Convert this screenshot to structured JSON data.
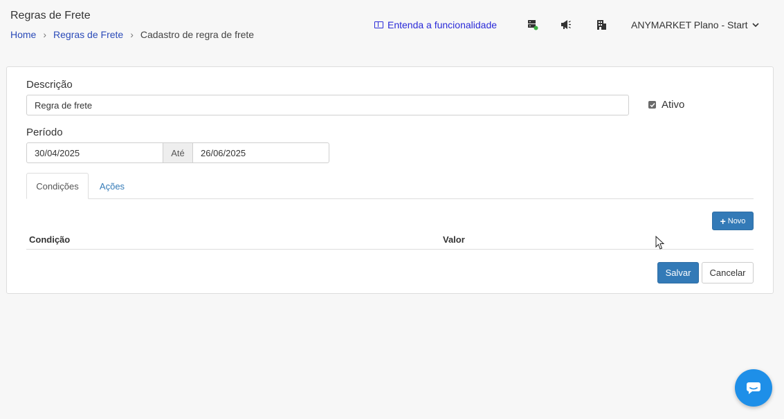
{
  "header": {
    "title": "Regras de Frete",
    "breadcrumb": [
      "Home",
      "Regras de Frete",
      "Cadastro de regra de frete"
    ],
    "help_link": "Entenda a funcionalidade",
    "icons": [
      "server-status-icon",
      "megaphone-icon",
      "building-icon"
    ],
    "account": "ANYMARKET Plano - Start"
  },
  "form": {
    "descricao_label": "Descrição",
    "descricao_value": "Regra de frete",
    "ativo_label": "Ativo",
    "ativo_checked": true,
    "periodo_label": "Período",
    "periodo_start": "30/04/2025",
    "periodo_sep": "Até",
    "periodo_end": "26/06/2025"
  },
  "tabs": [
    {
      "label": "Condições",
      "active": true
    },
    {
      "label": "Ações",
      "active": false
    }
  ],
  "table": {
    "new_button": "Novo",
    "columns": [
      "Condição",
      "Valor"
    ]
  },
  "actions": {
    "save": "Salvar",
    "cancel": "Cancelar"
  },
  "colors": {
    "primary": "#337ab7",
    "link": "#2a4ab8",
    "chat": "#1e8fe8",
    "status_green": "#3cb043"
  }
}
